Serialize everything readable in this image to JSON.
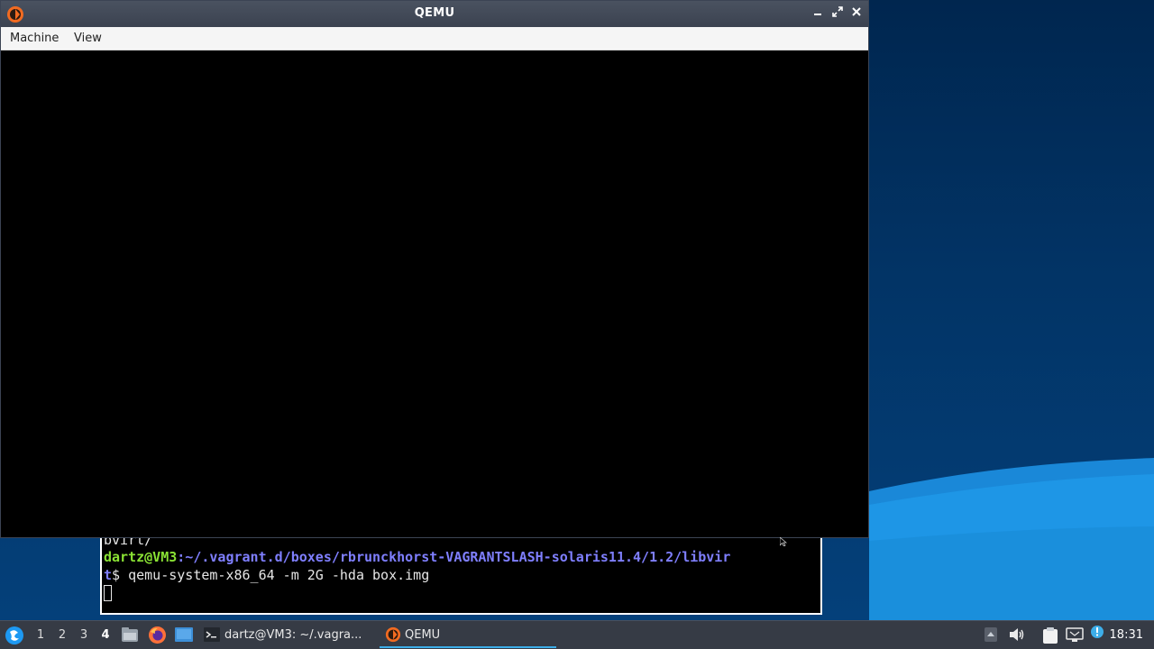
{
  "qemu_window": {
    "title": "QEMU",
    "menu": [
      "Machine",
      "View"
    ],
    "buttons": [
      "minimize",
      "maximize",
      "close"
    ]
  },
  "terminal": {
    "partial_line": "bvirt/",
    "prompt_user": "dartz@VM3",
    "prompt_path_line1": ":~/.vagrant.d/boxes/rbrunckhorst-VAGRANTSLASH-solaris11.4/1.2/libvir",
    "prompt_path_line2": "t",
    "prompt_symbol": "$ ",
    "command": "qemu-system-x86_64 -m 2G -hda box.img"
  },
  "taskbar": {
    "workspaces": [
      "1",
      "2",
      "3",
      "4"
    ],
    "active_workspace": "4",
    "tasks": [
      {
        "label": "dartz@VM3: ~/.vagra...",
        "icon": "terminal-icon"
      },
      {
        "label": "QEMU",
        "icon": "qemu-icon",
        "active": true
      }
    ],
    "clock": "18:31"
  },
  "colors": {
    "accent": "#3daee9",
    "terminal_user": "#8ae234",
    "terminal_path": "#7f7fff"
  }
}
